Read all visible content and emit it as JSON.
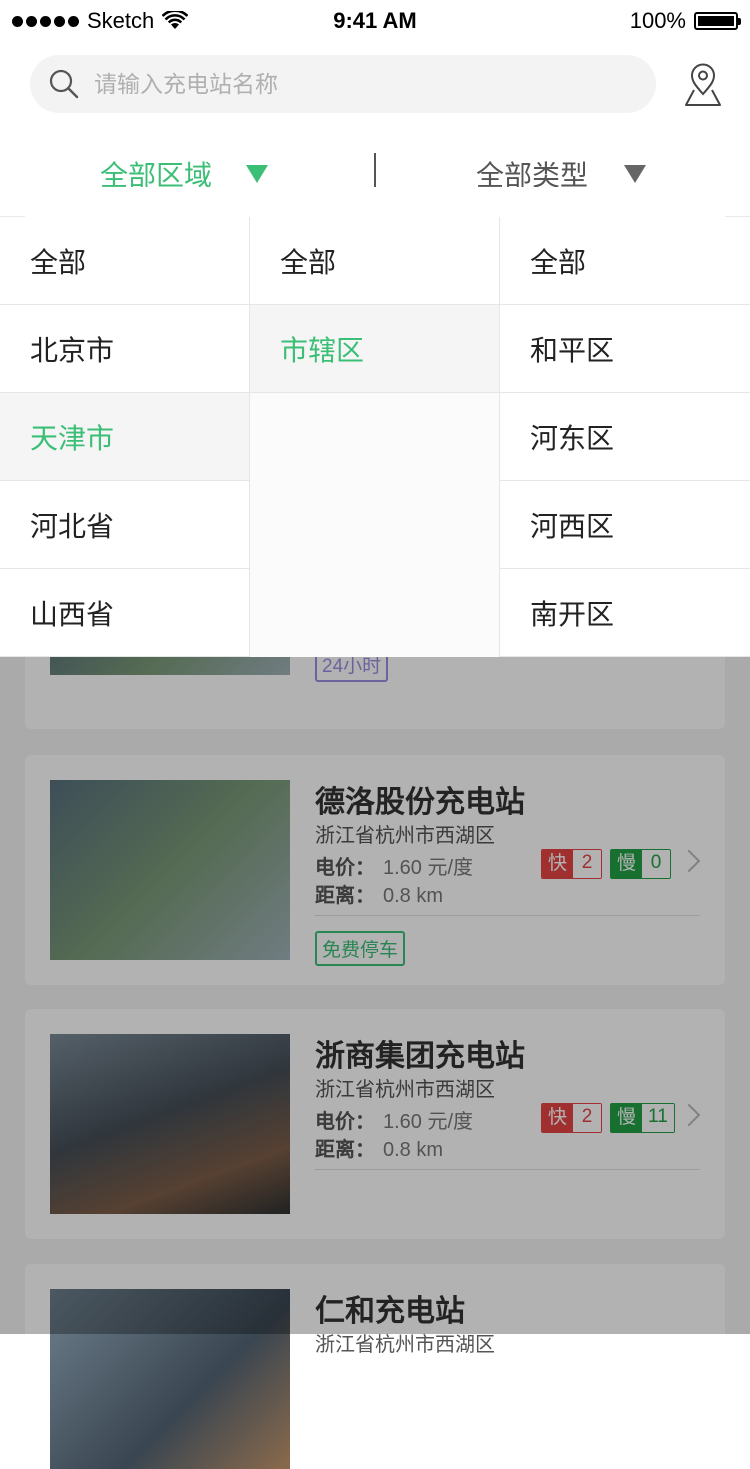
{
  "status_bar": {
    "carrier": "Sketch",
    "time": "9:41 AM",
    "battery": "100%"
  },
  "search": {
    "placeholder": "请输入充电站名称"
  },
  "filters": {
    "area_label": "全部区域",
    "type_label": "全部类型",
    "accent_color": "#3bbf76"
  },
  "dropdown": {
    "provinces": [
      "全部",
      "北京市",
      "天津市",
      "河北省",
      "山西省"
    ],
    "provinces_selected": 2,
    "cities": [
      "全部",
      "市辖区"
    ],
    "cities_selected": 1,
    "districts": [
      "全部",
      "和平区",
      "河东区",
      "河西区",
      "南开区"
    ]
  },
  "stations": [
    {
      "tag": "24小时"
    },
    {
      "name": "德洛股份充电站",
      "address": "浙江省杭州市西湖区",
      "price_label": "电价：",
      "price": "1.60 元/度",
      "distance_label": "距离：",
      "distance": "0.8 km",
      "fast_label": "快",
      "fast_count": "2",
      "slow_label": "慢",
      "slow_count": "0",
      "tag": "免费停车"
    },
    {
      "name": "浙商集团充电站",
      "address": "浙江省杭州市西湖区",
      "price_label": "电价：",
      "price": "1.60 元/度",
      "distance_label": "距离：",
      "distance": "0.8 km",
      "fast_label": "快",
      "fast_count": "2",
      "slow_label": "慢",
      "slow_count": "11"
    },
    {
      "name": "仁和充电站",
      "address": "浙江省杭州市西湖区"
    }
  ]
}
